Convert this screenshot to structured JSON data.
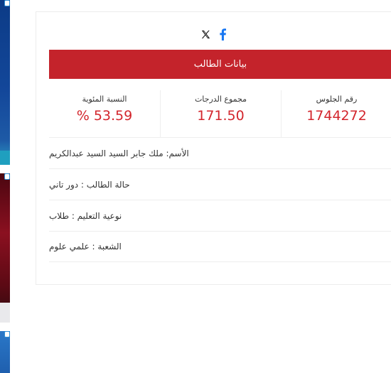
{
  "share": {
    "icons": [
      "x-icon",
      "facebook-icon"
    ]
  },
  "banner": {
    "title": "بيانات الطالب"
  },
  "stats": {
    "percentage": {
      "label": "النسبة المئوية",
      "value": "% 53.59"
    },
    "total": {
      "label": "مجموع الدرجات",
      "value": "171.50"
    },
    "seat_number": {
      "label": "رقم الجلوس",
      "value": "1744272"
    }
  },
  "details": {
    "name": "الأسم: ملك جابر السيد السيد عبدالكريم",
    "status": "حالة الطالب : دور تاني",
    "education_type": "نوعية التعليم : طلاب",
    "division": "الشعبة : علمي علوم"
  },
  "colors": {
    "accent": "#c4232b",
    "value_red": "#d3252c",
    "facebook_blue": "#1877f2"
  }
}
